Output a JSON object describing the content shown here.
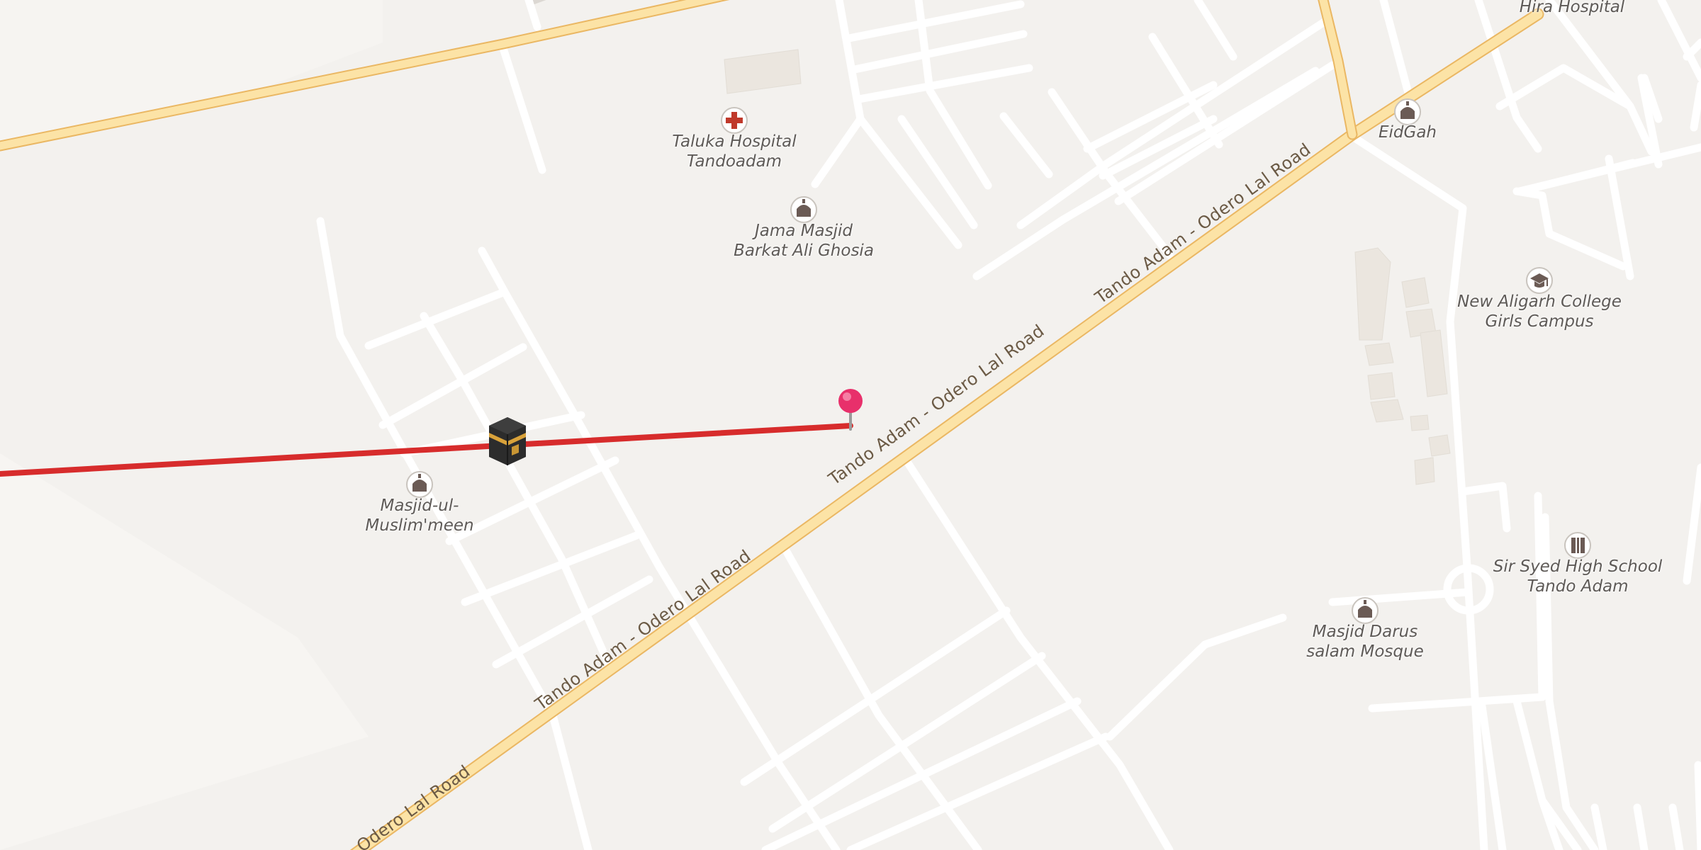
{
  "map": {
    "colors": {
      "background": "#f3f1ee",
      "minor_road": "#ffffff",
      "main_road": "#fce3a6",
      "main_road_casing": "#eab763",
      "route_line": "#d72c2c",
      "pin": "#e8306b",
      "building": "#ebe6df"
    },
    "roads": [
      {
        "name": "Tando Adam - Odero Lal Road",
        "labels": [
          "Tando Adam - Odero Lal Road",
          "Tando Adam - Odero Lal Road",
          "Tando Adam - Odero Lal Road",
          "Odero Lal Road"
        ]
      }
    ],
    "pois": [
      {
        "id": "taluka-hospital",
        "icon": "hospital-cross-icon",
        "lines": [
          "Taluka Hospital",
          "Tandoadam"
        ]
      },
      {
        "id": "jama-masjid",
        "icon": "mosque-icon",
        "lines": [
          "Jama Masjid",
          "Barkat Ali Ghosia"
        ]
      },
      {
        "id": "masjid-ul-muslimeen",
        "icon": "mosque-icon",
        "lines": [
          "Masjid-ul-",
          "Muslim'meen"
        ]
      },
      {
        "id": "eidgah",
        "icon": "mosque-icon",
        "lines": [
          "EidGah"
        ]
      },
      {
        "id": "hira-hospital",
        "icon": "",
        "lines": [
          "Hira Hospital"
        ]
      },
      {
        "id": "new-aligarh-college",
        "icon": "graduation-cap-icon",
        "lines": [
          "New Aligarh College",
          "Girls Campus"
        ]
      },
      {
        "id": "sir-syed-school",
        "icon": "school-icon",
        "lines": [
          "Sir Syed High School",
          "Tando Adam"
        ]
      },
      {
        "id": "masjid-darus-salam",
        "icon": "mosque-icon",
        "lines": [
          "Masjid Darus",
          "salam Mosque"
        ]
      }
    ],
    "markers": [
      {
        "id": "kaaba",
        "icon": "kaaba-icon"
      },
      {
        "id": "location-pin",
        "icon": "location-pin-icon"
      }
    ]
  }
}
